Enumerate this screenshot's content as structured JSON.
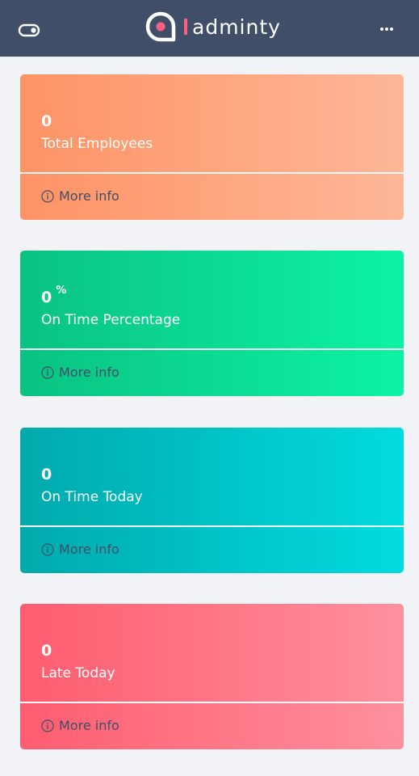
{
  "navbar": {
    "brand_name": "adminty",
    "toggle_icon": "toggle-icon",
    "more_icon": "more-horizontal-icon",
    "logo_icon": "adminty-logo-icon",
    "accent_color": "#fc6180",
    "background_color": "#404e67"
  },
  "cards": [
    {
      "value": "0",
      "unit": "",
      "label": "Total Employees",
      "footer_label": "More info",
      "gradient": [
        "#fe9365",
        "#feb798"
      ]
    },
    {
      "value": "0",
      "unit": "%",
      "label": "On Time Percentage",
      "footer_label": "More info",
      "gradient": [
        "#0ac282",
        "#0df3a3"
      ]
    },
    {
      "value": "0",
      "unit": "",
      "label": "On Time Today",
      "footer_label": "More info",
      "gradient": [
        "#01a9ac",
        "#01dbdf"
      ]
    },
    {
      "value": "0",
      "unit": "",
      "label": "Late Today",
      "footer_label": "More info",
      "gradient": [
        "#fe5d70",
        "#fe909d"
      ]
    }
  ]
}
